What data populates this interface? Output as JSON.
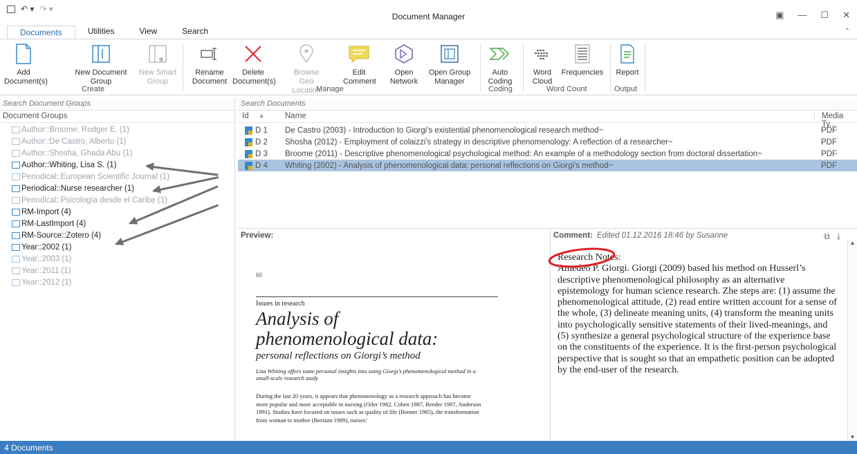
{
  "title": "Document Manager",
  "tabs": [
    "Documents",
    "Utilities",
    "View",
    "Search"
  ],
  "ribbon": {
    "add": "Add Document(s)",
    "new_group": "New Document Group",
    "new_smart": "New Smart Group",
    "create": "Create",
    "rename": "Rename Document",
    "delete": "Delete Document(s)",
    "browse_geo": "Browse Geo Location",
    "edit_comment": "Edit Comment",
    "open_network": "Open Network",
    "open_group_manager": "Open Group Manager",
    "manage": "Manage",
    "auto_coding": "Auto Coding",
    "coding": "Coding",
    "word_cloud": "Word Cloud",
    "frequencies": "Frequencies",
    "word_count": "Word Count",
    "report": "Report",
    "output": "Output"
  },
  "left": {
    "search_placeholder": "Search Document Groups",
    "column": "Document Groups",
    "groups": [
      "Author::Broome, Rodger E. (1)",
      "Author::De Castro, Alberto (1)",
      "Author::Shosha, Ghada Abu (1)",
      "Author::Whiting, Lisa S. (1)",
      "Periodical::European Scientific Journal (1)",
      "Periodical::Nurse researcher (1)",
      "Periodical::Psicología desde el Caribe (1)",
      "RM-Import (4)",
      "RM-LastImport (4)",
      "RM-Source::Zotero (4)",
      "Year::2002 (1)",
      "Year::2003 (1)",
      "Year::2011 (1)",
      "Year::2012 (1)"
    ]
  },
  "docs": {
    "search_placeholder": "Search Documents",
    "col_id": "Id",
    "col_name": "Name",
    "col_type": "Media Ty...",
    "rows": [
      {
        "id": "D 1",
        "name": "De Castro (2003) - Introduction to Giorgi's existential phenomenological research method~",
        "type": "PDF"
      },
      {
        "id": "D 2",
        "name": "Shosha (2012) - Employment of colaizzi's strategy in descriptive phenomenology: A reflection of a researcher~",
        "type": "PDF"
      },
      {
        "id": "D 3",
        "name": "Broome (2011) - Descriptive phenomenological psychological method: An example of a methodology section from doctoral dissertation~",
        "type": "PDF"
      },
      {
        "id": "D 4",
        "name": "Whiting (2002) - Analysis of phenomenological data: personal reflections on Giorgi's method~",
        "type": "PDF"
      }
    ]
  },
  "preview": {
    "label": "Preview:",
    "page": "60",
    "section": "Issues in research",
    "title1": "Analysis of",
    "title2": "phenomenological data:",
    "subtitle": "personal reflections on Giorgi’s method",
    "abstract": "Lisa Whiting offers some personal insights into using Giorgi’s phenomenological method in a small-scale research study",
    "body": "During the last 20 years, it appears that phenomenology as a research approach has become more popular and more acceptable in nursing (Oiler 1982, Cohen 1987, Reeder 1987, Anderson 1991). Studies have focused on issues such as quality of life (Benner 1985), the transformation from woman to mother (Berzum 1989), nurses’"
  },
  "comment": {
    "label": "Comment:",
    "meta": "Edited 01.12.2016 18:46 by Susanne",
    "heading": "Research Notes:",
    "text": "Amedeo P. Giorgi. Giorgi (2009) based his method on Husserl’s descriptive phenomenological philosophy as an alternative epistemology for human science research. Zhe steps are: (1) assume the phenomenological attitude, (2) read entire written account for a sense of the whole, (3) delineate meaning units, (4) transform the meaning units into psychologically sensitive statements of their lived-meanings, and (5) synthesize a general psychological structure of the experience base on the constituents of the experience. It is the first-person psychological perspective that is sought so that an empathetic position can be adopted by the end-user of the research."
  },
  "status": "4 Documents"
}
